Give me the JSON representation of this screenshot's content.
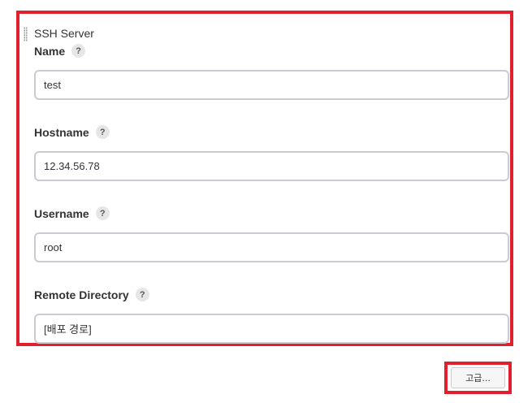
{
  "section": {
    "title": "SSH Server"
  },
  "fields": [
    {
      "label": "Name",
      "value": "test"
    },
    {
      "label": "Hostname",
      "value": "12.34.56.78"
    },
    {
      "label": "Username",
      "value": "root"
    },
    {
      "label": "Remote Directory",
      "value": "[배포 경로]"
    }
  ],
  "help_glyph": "?",
  "advanced": {
    "label": "고급..."
  },
  "colors": {
    "highlight": "#e0202d",
    "input_border": "#c9ccd2",
    "help_bg": "#e6e6e6"
  }
}
